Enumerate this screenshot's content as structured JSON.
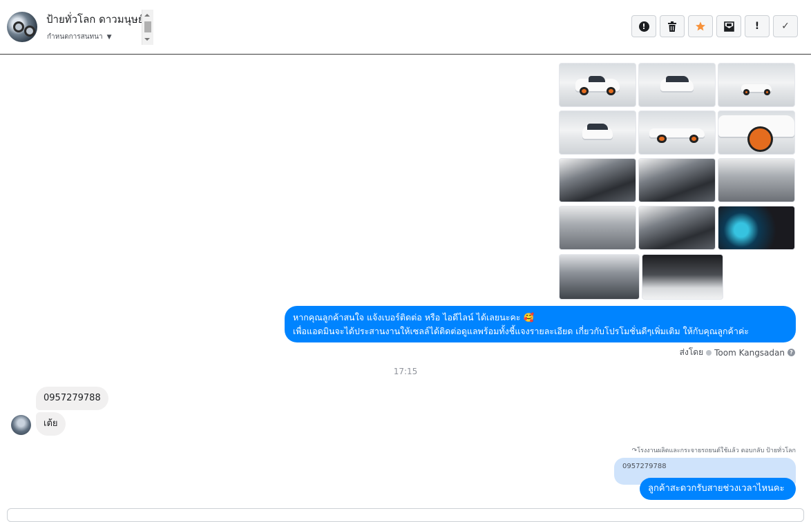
{
  "header": {
    "page_name": "ป้ายทั่วโลก ดาวมนุษย์",
    "subtitle": "กำหนดการสนทนา",
    "buttons": [
      {
        "name": "spam-button",
        "icon": "exclamation-circle-icon"
      },
      {
        "name": "delete-button",
        "icon": "trash-icon"
      },
      {
        "name": "star-button",
        "icon": "star-icon"
      },
      {
        "name": "mark-unread-button",
        "icon": "envelope-icon"
      },
      {
        "name": "important-button",
        "icon": "exclamation-icon",
        "label": "!"
      },
      {
        "name": "done-button",
        "icon": "check-icon",
        "label": "✓"
      }
    ]
  },
  "messages": {
    "promo_text_line1": "หากคุณลูกค้าสนใจ แจ้งเบอร์ติดต่อ หรือ ไอดีไลน์ ได้เลยนะคะ 🥰",
    "promo_text_line2": "เพื่อแอดมินจะได้ประสานงานให้เซลล์ได้ติดต่อดูแลพร้อมทั้งชี้แจงรายละเอียด เกี่ยวกับโปรโมชั่นดีๆเพิ่มเติม ให้กับคุณลูกค้าค่ะ",
    "sent_by_prefix": "ส่งโดย",
    "sent_by_name": "Toom Kangsadan",
    "timestamp": "17:15",
    "incoming_1": "0957279788",
    "incoming_2": "เต้ย",
    "reply_note": "โรงงานผลิตและกระจายรถยนต์ใช้แล้ว ตอบกลับ ป้ายทั่วโลก",
    "quoted_text": "0957279788",
    "reply_text": "ลูกค้าสะดวกรับสายช่วงเวลาไหนคะ"
  },
  "colors": {
    "outgoing_bubble": "#0084ff",
    "incoming_bubble": "#f1f0f0",
    "quoted_bubble": "#cfe3fb",
    "star_accent": "#f7923b"
  }
}
